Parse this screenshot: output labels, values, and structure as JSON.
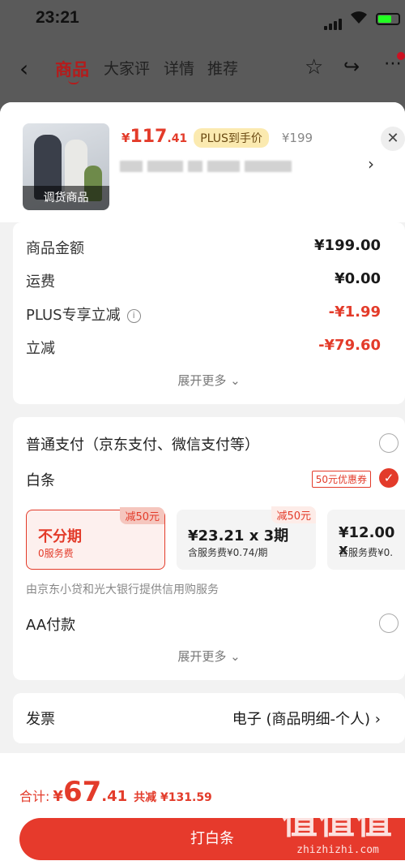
{
  "status": {
    "time": "23:21"
  },
  "nav": {
    "back_icon": "chevron-left-icon",
    "tabs": [
      "商品",
      "大家评",
      "详情",
      "推荐"
    ]
  },
  "product": {
    "thumb_caption": "调货商品",
    "price_symbol": "¥",
    "price_int": "117",
    "price_dec": ".41",
    "plus_tag": "PLUS到手价",
    "original_price": "¥199"
  },
  "summary": {
    "rows": [
      {
        "label": "商品金额",
        "value": "¥199.00"
      },
      {
        "label": "运费",
        "value": "¥0.00"
      },
      {
        "label": "PLUS专享立减",
        "value": "-¥1.99"
      },
      {
        "label": "立减",
        "value": "-¥79.60"
      }
    ],
    "expand": "展开更多"
  },
  "payment": {
    "normal": "普通支付（京东支付、微信支付等）",
    "baitiao": "白条",
    "coupon": "50元优惠券",
    "plans": [
      {
        "title": "不分期",
        "sub": "0服务费",
        "disc": "减50元",
        "selected": true
      },
      {
        "title": "¥23.21 x 3期",
        "sub": "含服务费¥0.74/期",
        "disc": "减50元",
        "selected": false
      },
      {
        "title": "¥12.00 x",
        "sub": "含服务费¥0.",
        "disc": "",
        "selected": false
      }
    ],
    "provider": "由京东小贷和光大银行提供信用购服务",
    "aa": "AA付款",
    "expand": "展开更多"
  },
  "invoice": {
    "label": "发票",
    "value": "电子 (商品明细-个人)"
  },
  "total": {
    "label": "合计:",
    "symbol": "¥",
    "int": "67",
    "dec": ".41",
    "saved": "共减 ¥131.59"
  },
  "pay_button": "打白条",
  "watermark": {
    "line1": "值值值",
    "line2": "zhizhizhi.com"
  },
  "colors": {
    "accent": "#e33b2a",
    "nav_active": "#b41c1c",
    "plus_tag_bg": "#fbeab0"
  }
}
